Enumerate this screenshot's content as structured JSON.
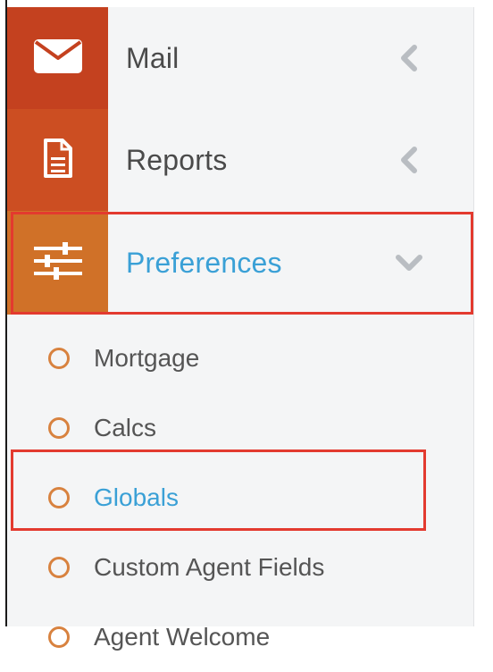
{
  "menu": {
    "items": [
      {
        "label": "Mail",
        "icon": "envelope-icon",
        "chevron": "chevron-left-icon"
      },
      {
        "label": "Reports",
        "icon": "document-icon",
        "chevron": "chevron-left-icon"
      },
      {
        "label": "Preferences",
        "icon": "sliders-icon",
        "chevron": "chevron-down-icon",
        "expanded": true,
        "active": true
      }
    ]
  },
  "submenu": {
    "items": [
      {
        "label": "Mortgage"
      },
      {
        "label": "Calcs"
      },
      {
        "label": "Globals",
        "active": true
      },
      {
        "label": "Custom Agent Fields"
      },
      {
        "label": "Agent Welcome"
      }
    ]
  },
  "colors": {
    "mail_icon_bg": "#c4411f",
    "reports_icon_bg": "#cc4e22",
    "prefs_icon_bg": "#d07128",
    "active_text": "#3aa0d6",
    "highlight_border": "#e33a2f",
    "sub_circle": "#d8823f"
  }
}
